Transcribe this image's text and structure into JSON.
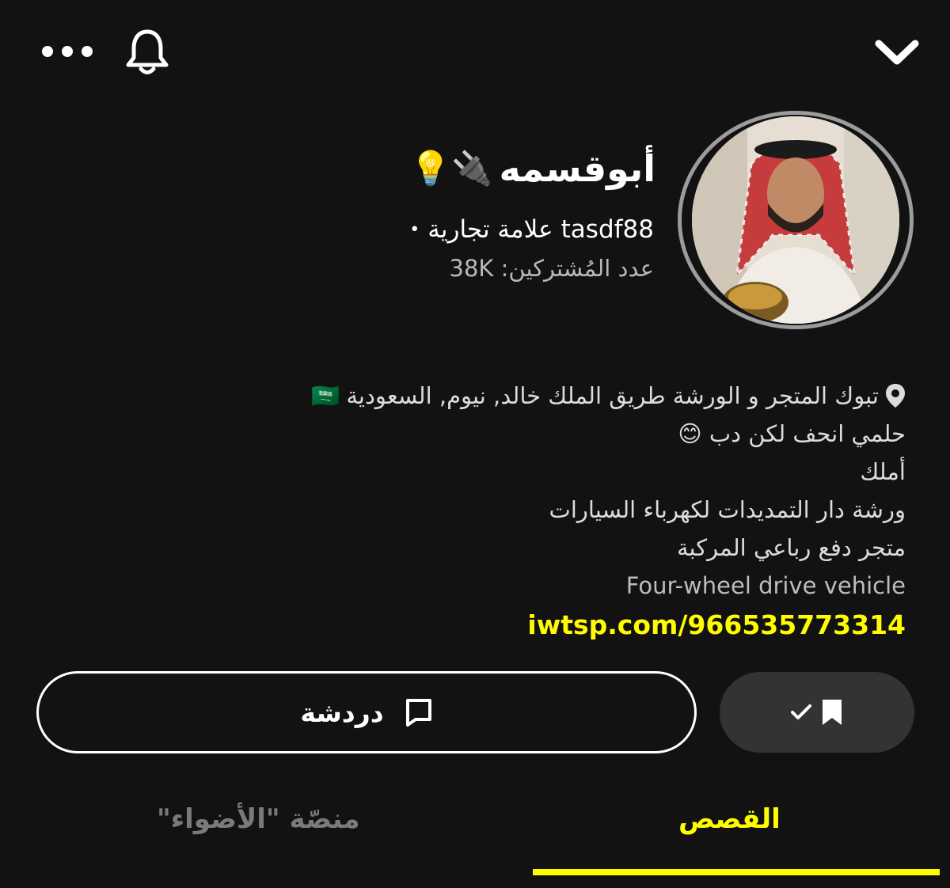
{
  "header": {
    "more_icon": "more-horizontal-icon",
    "bell_icon": "bell-icon",
    "collapse_icon": "chevron-down-icon"
  },
  "profile": {
    "display_name": "أبوقسمه",
    "name_emojis": "🔌💡",
    "handle": "tasdf88",
    "badge": "علامة تجارية",
    "subscribers_label": "عدد المُشتركين:",
    "subscribers_count": "38K"
  },
  "bio": {
    "location": "تبوك المتجر و الورشة طريق الملك خالد, نيوم, السعودية",
    "location_flag": "🇸🇦",
    "lines": [
      "حلمي انحف لكن دب 😊",
      "أملك",
      "ورشة دار التمديدات لكهرباء السيارات",
      "متجر دفع رباعي المركبة"
    ],
    "english_line": "Four-wheel drive vehicle",
    "link": "iwtsp.com/966535773314"
  },
  "actions": {
    "chat_label": "دردشة",
    "subscribe_icon": "bookmark-check-icon"
  },
  "tabs": {
    "stories": "القصص",
    "spotlight": "منصّة \"الأضواء\"",
    "active": "stories"
  },
  "colors": {
    "background": "#121212",
    "accent": "#fffc00",
    "button_dark": "#333333"
  }
}
